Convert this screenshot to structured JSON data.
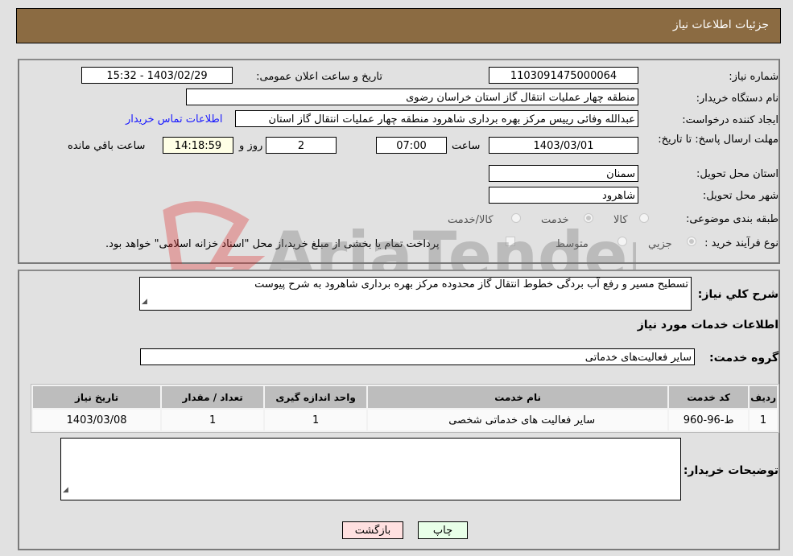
{
  "header": {
    "title": "جزئیات اطلاعات نیاز"
  },
  "form": {
    "need_number": {
      "label": "شماره نیاز:",
      "value": "1103091475000064"
    },
    "announce_datetime": {
      "label": "تاریخ و ساعت اعلان عمومی:",
      "value": "1403/02/29 - 15:32"
    },
    "buyer_org": {
      "label": "نام دستگاه خریدار:",
      "value": "منطقه چهار عملیات انتقال گاز   استان خراسان رضوی"
    },
    "requester": {
      "label": "ایجاد کننده درخواست:",
      "value": "عبدالله وفائی رییس مرکز بهره برداری شاهرود منطقه چهار عملیات انتقال گاز   استان"
    },
    "buyer_contact_link": "اطلاعات تماس خریدار",
    "deadline": {
      "label": "مهلت ارسال پاسخ: تا تاریخ:",
      "date": "1403/03/01",
      "time_label": "ساعت",
      "time": "07:00",
      "days": "2",
      "days_label": "روز و",
      "remaining": "14:18:59",
      "remaining_label": "ساعت باقي مانده"
    },
    "delivery_province": {
      "label": "استان محل تحویل:",
      "value": "سمنان"
    },
    "delivery_city": {
      "label": "شهر محل تحویل:",
      "value": "شاهرود"
    },
    "category": {
      "label": "طبقه بندی موضوعی:",
      "options": [
        "کالا",
        "خدمت",
        "کالا/خدمت"
      ],
      "selected": "خدمت"
    },
    "purchase_type": {
      "label": "نوع فرآیند خرید :",
      "options": [
        "جزيي",
        "متوسط"
      ],
      "selected": "جزيي",
      "treasury_note": "پرداخت تمام یا بخشی از مبلغ خرید،از محل \"اسناد خزانه اسلامی\" خواهد بود."
    }
  },
  "description": {
    "label": "شرح كلي نياز:",
    "value": "تسطیح مسیر و رفع آب بردگی خطوط انتقال گاز محدوده مرکز بهره برداری شاهرود به شرح پیوست"
  },
  "services_section": {
    "title": "اطلاعات خدمات مورد نیاز",
    "group_label": "گروه خدمت:",
    "group_value": "سایر فعالیت‌های خدماتی",
    "table": {
      "headers": [
        "ردیف",
        "کد خدمت",
        "نام خدمت",
        "واحد اندازه گیری",
        "تعداد / مقدار",
        "تاریخ نیاز"
      ],
      "rows": [
        [
          "1",
          "ط-96-960",
          "سایر فعالیت های خدماتی شخصی",
          "1",
          "1",
          "1403/03/08"
        ]
      ]
    }
  },
  "buyer_notes": {
    "label": "توضیحات خریدار:",
    "value": ""
  },
  "buttons": {
    "print": "چاپ",
    "back": "بازگشت"
  },
  "watermark": "AriaTender.neT"
}
